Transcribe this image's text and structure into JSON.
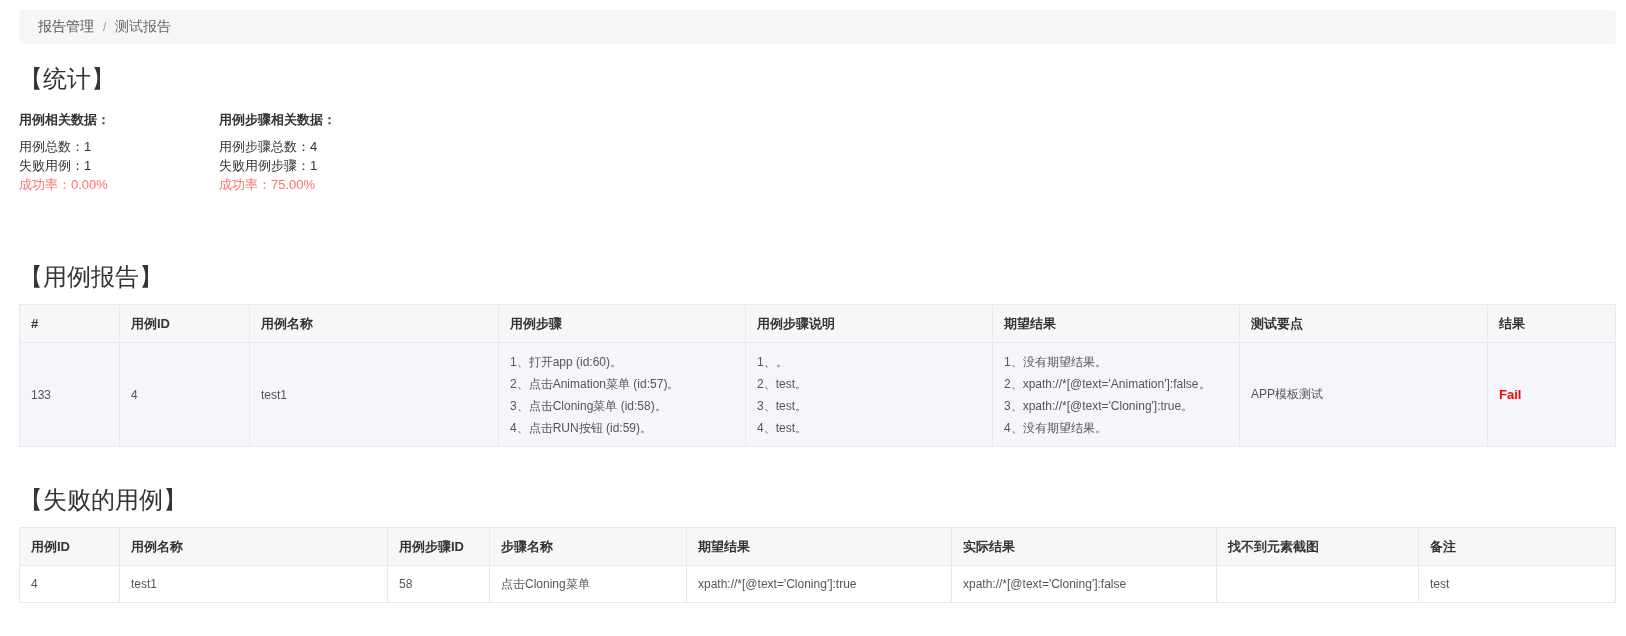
{
  "breadcrumb": [
    {
      "label": "报告管理",
      "selected": false
    },
    {
      "label": "/",
      "kind": "separator"
    },
    {
      "label": "测试报告",
      "selected": true
    }
  ],
  "stats": {
    "title": "【统计】",
    "groups": [
      {
        "heading": "用例相关数据：",
        "items": [
          {
            "text": "用例总数：1",
            "kind": "count"
          },
          {
            "text": "失败用例：1",
            "kind": "count"
          },
          {
            "text": "成功率：0.00%",
            "kind": "rate"
          }
        ]
      },
      {
        "heading": "用例步骤相关数据：",
        "items": [
          {
            "text": "用例步骤总数：4",
            "kind": "count"
          },
          {
            "text": "失败用例步骤：1",
            "kind": "count"
          },
          {
            "text": "成功率：75.00%",
            "kind": "rate"
          }
        ]
      }
    ]
  },
  "case_report": {
    "title": "【用例报告】",
    "columns": [
      "#",
      "用例ID",
      "用例名称",
      "用例步骤",
      "用例步骤说明",
      "期望结果",
      "测试要点",
      "结果"
    ],
    "rows": [
      {
        "cells": [
          [
            "133"
          ],
          [
            "4"
          ],
          [
            "test1"
          ],
          [
            "1、打开app (id:60)。",
            "2、点击Animation菜单 (id:57)。",
            "3、点击Cloning菜单 (id:58)。",
            "4、点击RUN按钮 (id:59)。"
          ],
          [
            "1、。",
            "2、test。",
            "3、test。",
            "4、test。"
          ],
          [
            "1、没有期望结果。",
            "2、xpath://*[@text='Animation']:false。",
            "3、xpath://*[@text='Cloning']:true。",
            "4、没有期望结果。"
          ],
          [
            "APP模板测试"
          ]
        ],
        "result": {
          "text": "Fail",
          "kind": "fail"
        }
      }
    ]
  },
  "failed_cases": {
    "title": "【失败的用例】",
    "columns": [
      "用例ID",
      "用例名称",
      "用例步骤ID",
      "步骤名称",
      "期望结果",
      "实际结果",
      "找不到元素截图",
      "备注"
    ],
    "rows": [
      [
        "4",
        "test1",
        "58",
        "点击Cloning菜单",
        "xpath://*[@text='Cloning']:true",
        "xpath://*[@text='Cloning']:false",
        "",
        "test"
      ]
    ]
  }
}
